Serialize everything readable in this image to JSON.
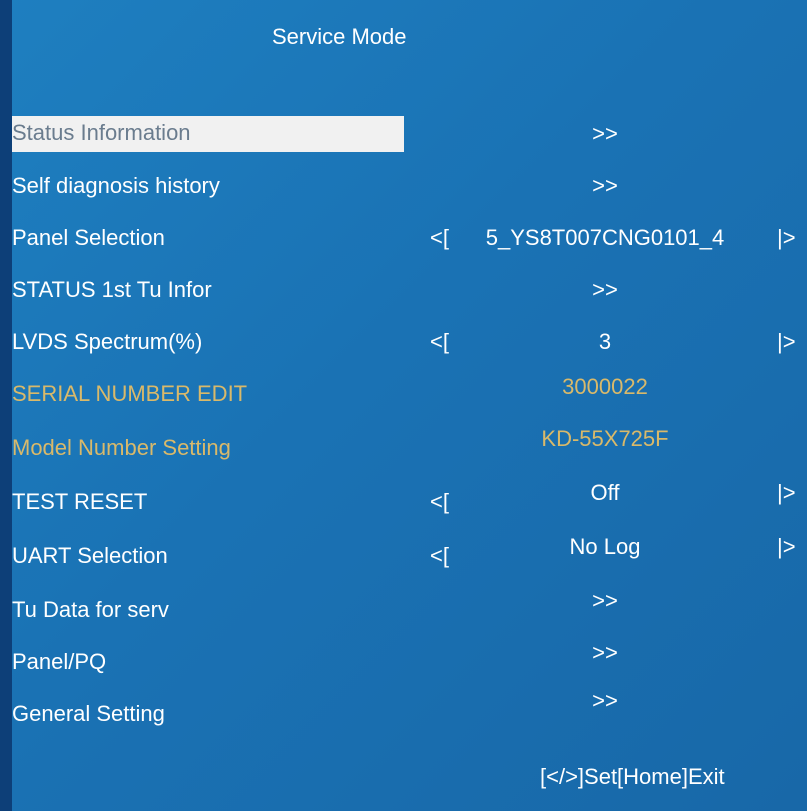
{
  "title": "Service Mode",
  "menu": [
    {
      "label": "Status Information",
      "value": ">>"
    },
    {
      "label": "Self diagnosis history",
      "value": ">>"
    },
    {
      "label": "Panel Selection",
      "value": "5_YS8T007CNG0101_4",
      "left_arrow": "<[",
      "right_arrow": "|>"
    },
    {
      "label": "STATUS 1st Tu Infor",
      "value": ">>"
    },
    {
      "label": "LVDS Spectrum(%)",
      "value": "3",
      "left_arrow": "<[",
      "right_arrow": "|>"
    },
    {
      "label": "SERIAL NUMBER EDIT",
      "value": "3000022"
    },
    {
      "label": "Model Number Setting",
      "value": "KD-55X725F"
    },
    {
      "label": "TEST RESET",
      "value": "Off",
      "left_arrow": "<[",
      "right_arrow": "|>"
    },
    {
      "label": "UART Selection",
      "value": "No Log",
      "left_arrow": "<[",
      "right_arrow": "|>"
    },
    {
      "label": "Tu Data for serv",
      "value": ">>"
    },
    {
      "label": "Panel/PQ",
      "value": ">>"
    },
    {
      "label": "General Setting",
      "value": ">>"
    }
  ],
  "footer": "[</>]Set[Home]Exit",
  "colors": {
    "background": "#1a72b4",
    "selected_bg": "#f1f1f1",
    "highlight_text": "#d9b96a"
  }
}
